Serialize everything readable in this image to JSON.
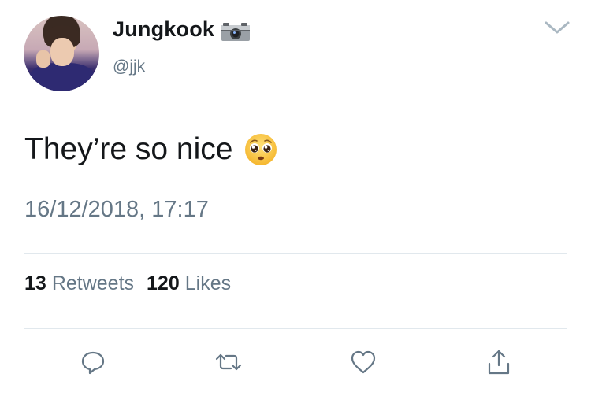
{
  "user": {
    "display_name": "Jungkook",
    "handle": "@jjk",
    "name_emoji": "camera-icon"
  },
  "tweet": {
    "text": "They’re so nice",
    "text_emoji": "pleading-face-icon",
    "timestamp": "16/12/2018, 17:17"
  },
  "stats": {
    "retweets_count": "13",
    "retweets_label": "Retweets",
    "likes_count": "120",
    "likes_label": "Likes"
  },
  "actions": {
    "reply": "reply-icon",
    "retweet": "retweet-icon",
    "like": "heart-icon",
    "share": "share-icon"
  },
  "colors": {
    "primary_text": "#14171a",
    "secondary_text": "#657786",
    "divider": "#e1e8ed",
    "icon": "#657786"
  }
}
